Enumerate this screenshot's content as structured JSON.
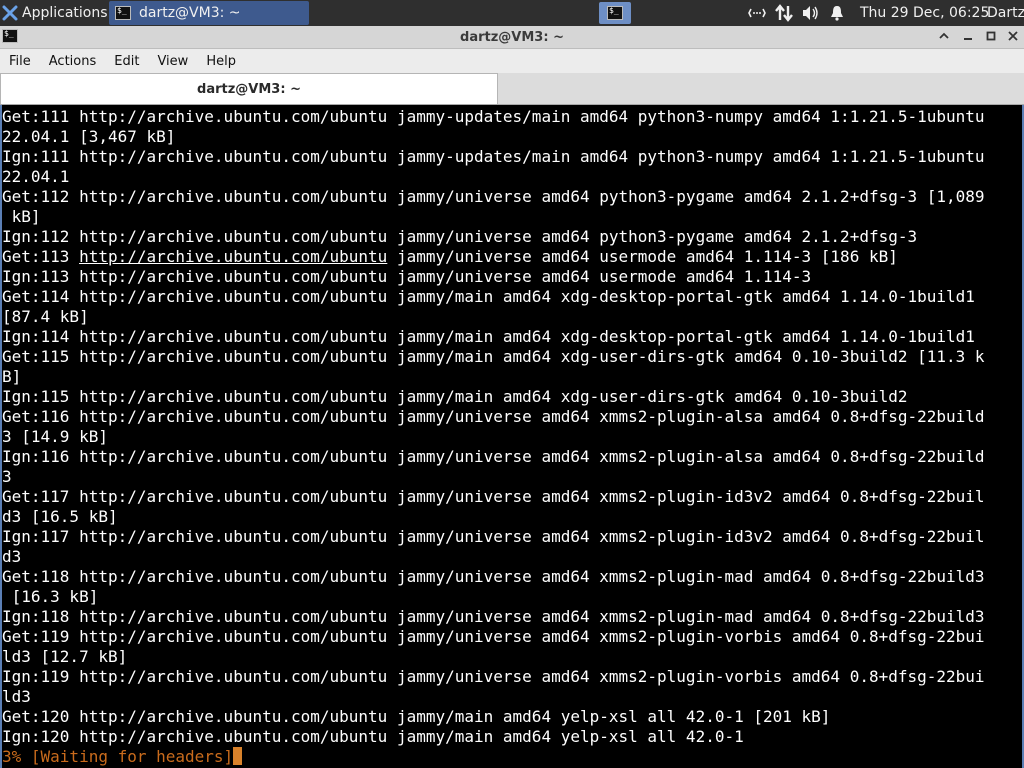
{
  "panel": {
    "applications_label": "Applications",
    "task_label": "dartz@VM3: ~",
    "clock": "Thu 29 Dec, 06:25",
    "user": "Dartz",
    "tray_icons": [
      "network-icon",
      "updown-arrows-icon",
      "volume-icon",
      "notification-bell-icon"
    ]
  },
  "window": {
    "title": "dartz@VM3: ~",
    "buttons": [
      "minimize",
      "restore",
      "maximize",
      "close"
    ]
  },
  "menu": [
    "File",
    "Actions",
    "Edit",
    "View",
    "Help"
  ],
  "tab": {
    "label": "dartz@VM3: ~"
  },
  "terminal": {
    "lines": [
      "Get:111 http://archive.ubuntu.com/ubuntu jammy-updates/main amd64 python3-numpy amd64 1:1.21.5-1ubuntu",
      "22.04.1 [3,467 kB]",
      "Ign:111 http://archive.ubuntu.com/ubuntu jammy-updates/main amd64 python3-numpy amd64 1:1.21.5-1ubuntu",
      "22.04.1",
      "Get:112 http://archive.ubuntu.com/ubuntu jammy/universe amd64 python3-pygame amd64 2.1.2+dfsg-3 [1,089",
      " kB]",
      "Ign:112 http://archive.ubuntu.com/ubuntu jammy/universe amd64 python3-pygame amd64 2.1.2+dfsg-3",
      "Get:113 http://archive.ubuntu.com/ubuntu jammy/universe amd64 usermode amd64 1.114-3 [186 kB]",
      "Ign:113 http://archive.ubuntu.com/ubuntu jammy/universe amd64 usermode amd64 1.114-3",
      "Get:114 http://archive.ubuntu.com/ubuntu jammy/main amd64 xdg-desktop-portal-gtk amd64 1.14.0-1build1",
      "[87.4 kB]",
      "Ign:114 http://archive.ubuntu.com/ubuntu jammy/main amd64 xdg-desktop-portal-gtk amd64 1.14.0-1build1",
      "Get:115 http://archive.ubuntu.com/ubuntu jammy/main amd64 xdg-user-dirs-gtk amd64 0.10-3build2 [11.3 k",
      "B]",
      "Ign:115 http://archive.ubuntu.com/ubuntu jammy/main amd64 xdg-user-dirs-gtk amd64 0.10-3build2",
      "Get:116 http://archive.ubuntu.com/ubuntu jammy/universe amd64 xmms2-plugin-alsa amd64 0.8+dfsg-22build",
      "3 [14.9 kB]",
      "Ign:116 http://archive.ubuntu.com/ubuntu jammy/universe amd64 xmms2-plugin-alsa amd64 0.8+dfsg-22build",
      "3",
      "Get:117 http://archive.ubuntu.com/ubuntu jammy/universe amd64 xmms2-plugin-id3v2 amd64 0.8+dfsg-22buil",
      "d3 [16.5 kB]",
      "Ign:117 http://archive.ubuntu.com/ubuntu jammy/universe amd64 xmms2-plugin-id3v2 amd64 0.8+dfsg-22buil",
      "d3",
      "Get:118 http://archive.ubuntu.com/ubuntu jammy/universe amd64 xmms2-plugin-mad amd64 0.8+dfsg-22build3",
      " [16.3 kB]",
      "Ign:118 http://archive.ubuntu.com/ubuntu jammy/universe amd64 xmms2-plugin-mad amd64 0.8+dfsg-22build3",
      "Get:119 http://archive.ubuntu.com/ubuntu jammy/universe amd64 xmms2-plugin-vorbis amd64 0.8+dfsg-22bui",
      "ld3 [12.7 kB]",
      "Ign:119 http://archive.ubuntu.com/ubuntu jammy/universe amd64 xmms2-plugin-vorbis amd64 0.8+dfsg-22bui",
      "ld3",
      "Get:120 http://archive.ubuntu.com/ubuntu jammy/main amd64 yelp-xsl all 42.0-1 [201 kB]",
      "Ign:120 http://archive.ubuntu.com/ubuntu jammy/main amd64 yelp-xsl all 42.0-1"
    ],
    "underlined_url_line_index": 7,
    "status_line": "3% [Waiting for headers]",
    "status_color": "#c96b1c",
    "cursor_color": "#d9822b",
    "background": "#000000",
    "foreground": "#ffffff"
  }
}
